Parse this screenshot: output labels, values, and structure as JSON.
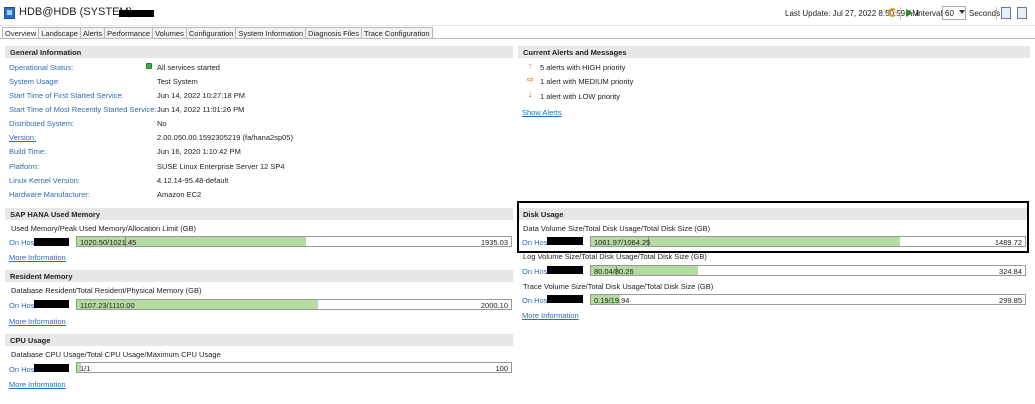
{
  "title": {
    "text": "HDB@HDB (SYSTEM)"
  },
  "toolbar": {
    "last_update": "Last Update:  Jul 27, 2022 8:50:59 AM",
    "interval_label": "Interval:",
    "interval_value": "60",
    "seconds_label": "Seconds"
  },
  "tabs": [
    "Overview",
    "Landscape",
    "Alerts",
    "Performance",
    "Volumes",
    "Configuration",
    "System Information",
    "Diagnosis Files",
    "Trace Configuration"
  ],
  "general": {
    "header": "General Information",
    "rows": [
      {
        "label": "Operational Status:",
        "value": "All services started"
      },
      {
        "label": "System Usage:",
        "value": "Test System"
      },
      {
        "label": "Start Time of First Started Service:",
        "value": "Jun 14, 2022 10:27:18 PM"
      },
      {
        "label": "Start Time of Most Recently Started Service:",
        "value": "Jun 14, 2022 11:01:26 PM"
      },
      {
        "label": "Distributed System:",
        "value": "No"
      },
      {
        "label": "Version:",
        "value": "2.00.050.00.1592305219 (fa/hana2sp05)"
      },
      {
        "label": "Build Time:",
        "value": "Jun 16, 2020 1:10:42 PM"
      },
      {
        "label": "Platform:",
        "value": "SUSE Linux Enterprise Server 12 SP4"
      },
      {
        "label": "Linux Kernel Version:",
        "value": "4.12.14-95.48-default"
      },
      {
        "label": "Hardware Manufacturer:",
        "value": "Amazon EC2"
      }
    ]
  },
  "alerts": {
    "header": "Current Alerts and Messages",
    "items": [
      {
        "text": "5 alerts with HIGH priority",
        "color": "#d9534f"
      },
      {
        "text": "1 alert with MEDIUM priority",
        "color": "#e8a21a"
      },
      {
        "text": "1 alert with LOW priority",
        "color": "#555555"
      }
    ],
    "show_link": "Show Alerts"
  },
  "used_memory": {
    "header": "SAP HANA Used Memory",
    "subtitle": "Used Memory/Peak Used Memory/Allocation Limit (GB)",
    "on_host": "On Host",
    "bar_label": "1020.50/1021.45",
    "bar_max": "1935.03",
    "fill_fraction": 0.527,
    "more": "More Information"
  },
  "resident_memory": {
    "header": "Resident Memory",
    "subtitle": "Database Resident/Total Resident/Physical Memory (GB)",
    "on_host": "On Host",
    "bar_label": "1107.23/1110.00",
    "bar_max": "2000.10",
    "fill_fraction": 0.555,
    "more": "More Information"
  },
  "cpu": {
    "header": "CPU Usage",
    "subtitle": "Database CPU Usage/Total CPU Usage/Maximum CPU Usage",
    "on_host": "On Host",
    "bar_label": "1/1",
    "bar_max": "100",
    "fill_fraction": 0.01,
    "more": "More Information"
  },
  "disk": {
    "header": "Disk Usage",
    "data_subtitle": "Data Volume Size/Total Disk Usage/Total Disk Size (GB)",
    "data_on_host": "On Host",
    "data_bar_label": "1061.97/1064.25",
    "data_bar_max": "1489.72",
    "data_fill_fraction": 0.713,
    "log_subtitle": "Log Volume Size/Total Disk Usage/Total Disk Size (GB)",
    "log_on_host": "On Host",
    "log_bar_label": "80.04/80.26",
    "log_bar_max": "324.84",
    "log_fill_fraction": 0.247,
    "trace_subtitle": "Trace Volume Size/Total Disk Usage/Total Disk Size (GB)",
    "trace_on_host": "On Host",
    "trace_bar_label": "0.19/19.94",
    "trace_bar_max": "299.85",
    "trace_fill_fraction": 0.066,
    "more": "More Information"
  }
}
